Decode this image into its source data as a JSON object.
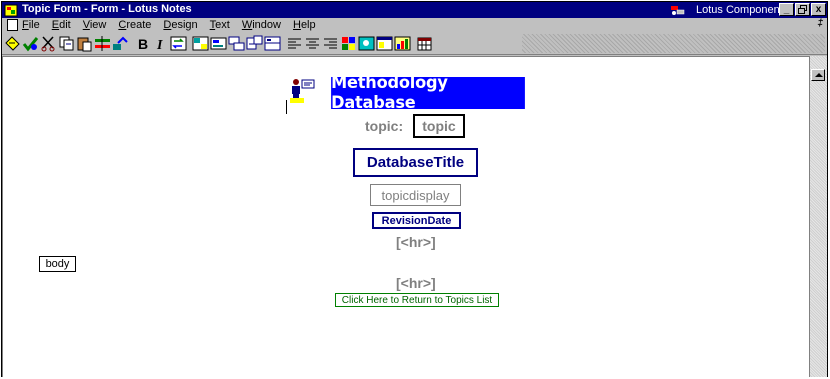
{
  "window": {
    "title": "Topic Form - Form - Lotus Notes",
    "components_label": "Lotus Components",
    "buttons": [
      "_",
      "·",
      "x"
    ],
    "restore_glyph": "‡"
  },
  "menu": {
    "items": [
      "File",
      "Edit",
      "View",
      "Create",
      "Design",
      "Text",
      "Window",
      "Help"
    ]
  },
  "toolbar": {
    "icons": [
      "edit-mode-icon",
      "check-icon",
      "cut-icon",
      "copy-icon",
      "paste-icon",
      "tab-icon",
      "link-icon",
      "bold-icon",
      "italic-icon",
      "refresh-icon",
      "table-icon",
      "field-icon",
      "section-icon",
      "button-icon",
      "hotspot-icon",
      "align-left-icon",
      "align-center-icon",
      "align-right-icon",
      "properties-icon",
      "image-icon",
      "window-icon",
      "chart-icon",
      "calendar-icon"
    ]
  },
  "form": {
    "banner_title": "Methodology Database",
    "topic_label": "topic:",
    "topic_field": "topic",
    "database_title_field": "DatabaseTitle",
    "topicdisplay_field": "topicdisplay",
    "revision_date_field": "RevisionDate",
    "hr_1": "[<hr>]",
    "body_field": "body",
    "hr_2": "[<hr>]",
    "return_link": "Click Here to Return to Topics List"
  },
  "colors": {
    "title_bar": "#000080",
    "banner": "#0000ff",
    "field_text": "#000080",
    "label_gray": "#808080",
    "link_green": "#008000"
  }
}
